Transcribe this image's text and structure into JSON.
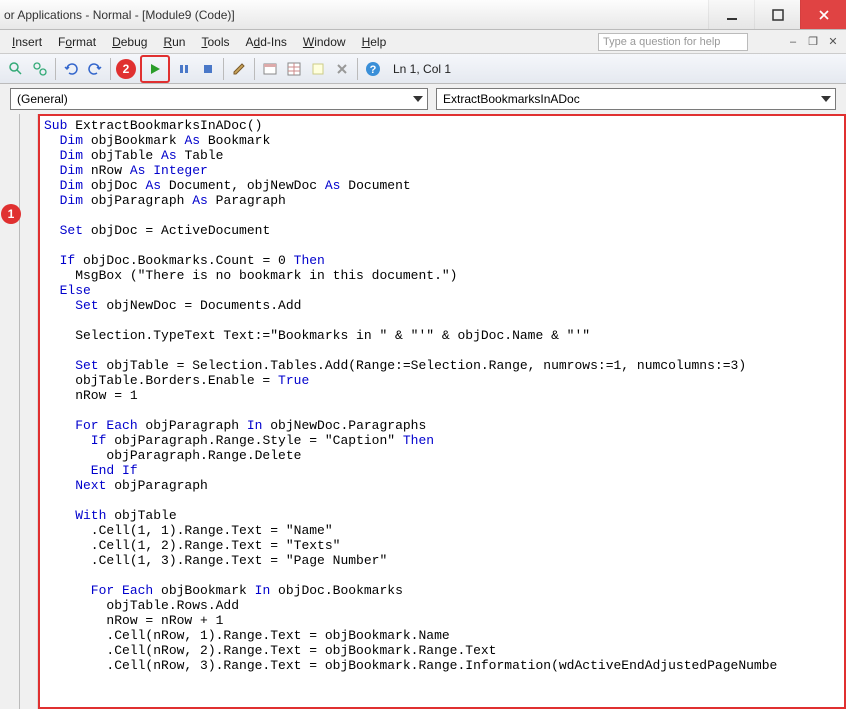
{
  "title": "or Applications - Normal - [Module9 (Code)]",
  "menu": {
    "insert": {
      "u": "I",
      "rest": "nsert"
    },
    "format": {
      "u": "o",
      "pre": "F",
      "rest": "rmat"
    },
    "debug": {
      "u": "D",
      "rest": "ebug"
    },
    "run": {
      "u": "R",
      "rest": "un"
    },
    "tools": {
      "u": "T",
      "rest": "ools"
    },
    "addins": {
      "u": "d",
      "pre": "A",
      "rest": "d-Ins"
    },
    "window": {
      "u": "W",
      "rest": "indow"
    },
    "help": {
      "u": "H",
      "rest": "elp"
    }
  },
  "help_placeholder": "Type a question for help",
  "coord": "Ln 1, Col 1",
  "dd_left": "(General)",
  "dd_right": "ExtractBookmarksInADoc",
  "callouts": {
    "c1": "1",
    "c2": "2"
  },
  "code": {
    "l1a": "Sub",
    "l1b": " ExtractBookmarksInADoc()",
    "l2a": "  Dim",
    "l2b": " objBookmark ",
    "l2c": "As",
    "l2d": " Bookmark",
    "l3a": "  Dim",
    "l3b": " objTable ",
    "l3c": "As",
    "l3d": " Table",
    "l4a": "  Dim",
    "l4b": " nRow ",
    "l4c": "As Integer",
    "l5a": "  Dim",
    "l5b": " objDoc ",
    "l5c": "As",
    "l5d": " Document, objNewDoc ",
    "l5e": "As",
    "l5f": " Document",
    "l6a": "  Dim",
    "l6b": " objParagraph ",
    "l6c": "As",
    "l6d": " Paragraph",
    "blank": "",
    "l8a": "  Set",
    "l8b": " objDoc = ActiveDocument",
    "l10a": "  If",
    "l10b": " objDoc.Bookmarks.Count = 0 ",
    "l10c": "Then",
    "l11": "    MsgBox (\"There is no bookmark in this document.\")",
    "l12": "  Else",
    "l13a": "    Set",
    "l13b": " objNewDoc = Documents.Add",
    "l15": "    Selection.TypeText Text:=\"Bookmarks in \" & \"'\" & objDoc.Name & \"'\"",
    "l17a": "    Set",
    "l17b": " objTable = Selection.Tables.Add(Range:=Selection.Range, numrows:=1, numcolumns:=3)",
    "l18a": "    objTable.Borders.Enable = ",
    "l18b": "True",
    "l19": "    nRow = 1",
    "l21a": "    For Each",
    "l21b": " objParagraph ",
    "l21c": "In",
    "l21d": " objNewDoc.Paragraphs",
    "l22a": "      If",
    "l22b": " objParagraph.Range.Style = \"Caption\" ",
    "l22c": "Then",
    "l23": "        objParagraph.Range.Delete",
    "l24": "      End If",
    "l25a": "    Next",
    "l25b": " objParagraph",
    "l27a": "    With",
    "l27b": " objTable",
    "l28": "      .Cell(1, 1).Range.Text = \"Name\"",
    "l29": "      .Cell(1, 2).Range.Text = \"Texts\"",
    "l30": "      .Cell(1, 3).Range.Text = \"Page Number\"",
    "l32a": "      For Each",
    "l32b": " objBookmark ",
    "l32c": "In",
    "l32d": " objDoc.Bookmarks",
    "l33": "        objTable.Rows.Add",
    "l34": "        nRow = nRow + 1",
    "l35": "        .Cell(nRow, 1).Range.Text = objBookmark.Name",
    "l36": "        .Cell(nRow, 2).Range.Text = objBookmark.Range.Text",
    "l37": "        .Cell(nRow, 3).Range.Text = objBookmark.Range.Information(wdActiveEndAdjustedPageNumbe"
  }
}
